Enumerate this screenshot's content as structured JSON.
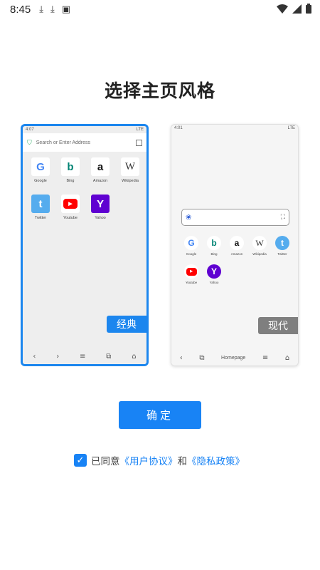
{
  "status_bar": {
    "time": "8:45",
    "icons_left": [
      "download-icon",
      "download-icon",
      "app-store-icon"
    ],
    "icons_right": [
      "wifi-icon",
      "signal-icon",
      "battery-icon"
    ]
  },
  "title": "选择主页风格",
  "classic": {
    "mini_time": "4:07",
    "mini_network": "LTE",
    "address_placeholder": "Search or Enter Address",
    "tiles": [
      {
        "label": "Google",
        "glyph": "G",
        "icon": "google-icon"
      },
      {
        "label": "Bing",
        "glyph": "b",
        "icon": "bing-icon"
      },
      {
        "label": "Amazon",
        "glyph": "a",
        "icon": "amazon-icon"
      },
      {
        "label": "Wikipedia",
        "glyph": "W",
        "icon": "wikipedia-icon"
      },
      {
        "label": "Twitter",
        "glyph": "t",
        "icon": "twitter-icon"
      },
      {
        "label": "Youtube",
        "glyph": "▶",
        "icon": "youtube-icon"
      },
      {
        "label": "Yahoo",
        "glyph": "Y",
        "icon": "yahoo-icon"
      }
    ],
    "style_label": "经典",
    "nav_icons": [
      "back-icon",
      "forward-icon",
      "menu-icon",
      "tabs-icon",
      "home-icon"
    ]
  },
  "modern": {
    "mini_time": "4:01",
    "mini_network": "LTE",
    "tiles": [
      {
        "label": "Google",
        "glyph": "G",
        "icon": "google-icon"
      },
      {
        "label": "Bing",
        "glyph": "b",
        "icon": "bing-icon"
      },
      {
        "label": "Amazon",
        "glyph": "a",
        "icon": "amazon-icon"
      },
      {
        "label": "Wikipedia",
        "glyph": "W",
        "icon": "wikipedia-icon"
      },
      {
        "label": "Twitter",
        "glyph": "t",
        "icon": "twitter-icon"
      },
      {
        "label": "Youtube",
        "glyph": "▶",
        "icon": "youtube-icon"
      },
      {
        "label": "Yahoo",
        "glyph": "Y",
        "icon": "yahoo-icon"
      }
    ],
    "style_label": "现代",
    "nav_homepage": "Homepage"
  },
  "confirm_label": "确定",
  "agreement": {
    "checked": true,
    "prefix": "已同意",
    "user_agreement": "《用户协议》",
    "joiner": "和",
    "privacy_policy": "《隐私政策》"
  },
  "colors": {
    "accent": "#1883f5",
    "modern_tag": "#7f7f7f"
  }
}
